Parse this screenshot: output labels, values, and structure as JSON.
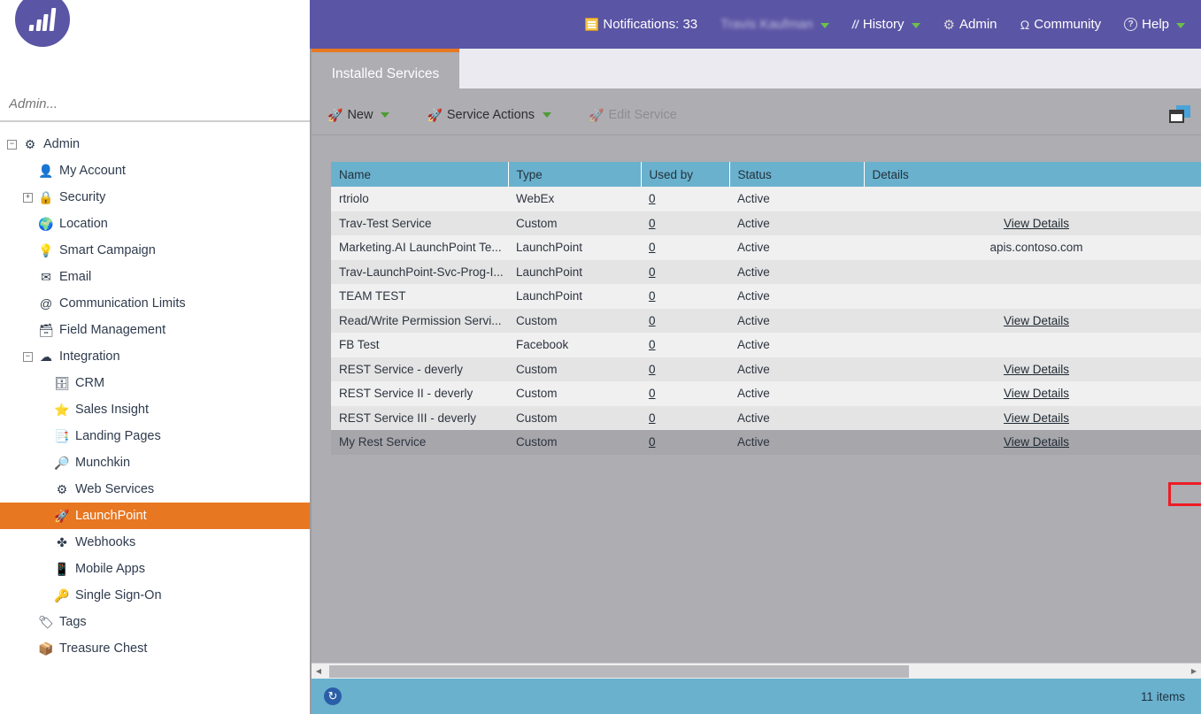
{
  "topbar": {
    "notifications": {
      "label": "Notifications: 33",
      "icon": "note-icon"
    },
    "user": {
      "label": "Travis Kaufman",
      "icon": "user-caret"
    },
    "history": {
      "label": "History",
      "icon": "footprints-icon"
    },
    "admin": {
      "label": "Admin",
      "icon": "gear-icon"
    },
    "community": {
      "label": "Community",
      "icon": "community-icon"
    },
    "help": {
      "label": "Help",
      "icon": "question-circle-icon"
    }
  },
  "sidebar": {
    "search_placeholder": "Admin...",
    "logo": "marketo-bars-logo",
    "items": [
      {
        "label": "Admin",
        "icon": "gear-icon",
        "depth": 0,
        "toggle": "minus",
        "selected": false
      },
      {
        "label": "My Account",
        "icon": "person-icon",
        "depth": 1,
        "toggle": "none",
        "selected": false
      },
      {
        "label": "Security",
        "icon": "lock-icon",
        "depth": 1,
        "toggle": "plus",
        "selected": false
      },
      {
        "label": "Location",
        "icon": "globe-pin-icon",
        "depth": 1,
        "toggle": "none",
        "selected": false
      },
      {
        "label": "Smart Campaign",
        "icon": "lightbulb-icon",
        "depth": 1,
        "toggle": "none",
        "selected": false
      },
      {
        "label": "Email",
        "icon": "envelope-icon",
        "depth": 1,
        "toggle": "none",
        "selected": false
      },
      {
        "label": "Communication Limits",
        "icon": "at-sign-icon",
        "depth": 1,
        "toggle": "none",
        "selected": false
      },
      {
        "label": "Field Management",
        "icon": "database-grid-icon",
        "depth": 1,
        "toggle": "none",
        "selected": false
      },
      {
        "label": "Integration",
        "icon": "cloud-icon",
        "depth": 1,
        "toggle": "minus",
        "selected": false
      },
      {
        "label": "CRM",
        "icon": "database-icon",
        "depth": 2,
        "toggle": "none",
        "selected": false
      },
      {
        "label": "Sales Insight",
        "icon": "star-flame-icon",
        "depth": 2,
        "toggle": "none",
        "selected": false
      },
      {
        "label": "Landing Pages",
        "icon": "page-layout-icon",
        "depth": 2,
        "toggle": "none",
        "selected": false
      },
      {
        "label": "Munchkin",
        "icon": "magnifier-globe-icon",
        "depth": 2,
        "toggle": "none",
        "selected": false
      },
      {
        "label": "Web Services",
        "icon": "gears-icon",
        "depth": 2,
        "toggle": "none",
        "selected": false
      },
      {
        "label": "LaunchPoint",
        "icon": "rocket-icon",
        "depth": 2,
        "toggle": "none",
        "selected": true
      },
      {
        "label": "Webhooks",
        "icon": "node-link-icon",
        "depth": 2,
        "toggle": "none",
        "selected": false
      },
      {
        "label": "Mobile Apps",
        "icon": "phone-icon",
        "depth": 2,
        "toggle": "none",
        "selected": false
      },
      {
        "label": "Single Sign-On",
        "icon": "key-icon",
        "depth": 2,
        "toggle": "none",
        "selected": false
      },
      {
        "label": "Tags",
        "icon": "tag-icon",
        "depth": 1,
        "toggle": "none",
        "selected": false
      },
      {
        "label": "Treasure Chest",
        "icon": "chest-icon",
        "depth": 1,
        "toggle": "none",
        "selected": false
      }
    ]
  },
  "main": {
    "tab_label": "Installed Services",
    "toolbar": {
      "new_label": "New",
      "service_actions_label": "Service Actions",
      "edit_service_label": "Edit Service",
      "window_toggle": "panel-toggle-icon"
    },
    "table": {
      "columns": [
        "Name",
        "Type",
        "Used by",
        "Status",
        "Details"
      ],
      "rows": [
        {
          "name": "rtriolo",
          "type": "WebEx",
          "used_by": "0",
          "status": "Active",
          "details": "",
          "details_link": false,
          "selected": false
        },
        {
          "name": "Trav-Test Service",
          "type": "Custom",
          "used_by": "0",
          "status": "Active",
          "details": "View Details",
          "details_link": true,
          "selected": false
        },
        {
          "name": "Marketing.AI LaunchPoint Te...",
          "type": "LaunchPoint",
          "used_by": "0",
          "status": "Active",
          "details": "apis.contoso.com",
          "details_link": false,
          "selected": false
        },
        {
          "name": "Trav-LaunchPoint-Svc-Prog-I...",
          "type": "LaunchPoint",
          "used_by": "0",
          "status": "Active",
          "details": "",
          "details_link": false,
          "selected": false
        },
        {
          "name": "TEAM TEST",
          "type": "LaunchPoint",
          "used_by": "0",
          "status": "Active",
          "details": "",
          "details_link": false,
          "selected": false
        },
        {
          "name": "Read/Write Permission Servi...",
          "type": "Custom",
          "used_by": "0",
          "status": "Active",
          "details": "View Details",
          "details_link": true,
          "selected": false
        },
        {
          "name": "FB Test",
          "type": "Facebook",
          "used_by": "0",
          "status": "Active",
          "details": "",
          "details_link": false,
          "selected": false
        },
        {
          "name": "REST Service - deverly",
          "type": "Custom",
          "used_by": "0",
          "status": "Active",
          "details": "View Details",
          "details_link": true,
          "selected": false
        },
        {
          "name": "REST Service II - deverly",
          "type": "Custom",
          "used_by": "0",
          "status": "Active",
          "details": "View Details",
          "details_link": true,
          "selected": false
        },
        {
          "name": "REST Service III - deverly",
          "type": "Custom",
          "used_by": "0",
          "status": "Active",
          "details": "View Details",
          "details_link": true,
          "selected": false
        },
        {
          "name": "My Rest Service",
          "type": "Custom",
          "used_by": "0",
          "status": "Active",
          "details": "View Details",
          "details_link": true,
          "selected": true
        }
      ]
    },
    "statusbar": {
      "refresh_icon": "refresh-icon",
      "items_label": "11 items"
    }
  },
  "annotation": {
    "highlight_color": "#ee1c25",
    "highlight_target": "View Details"
  },
  "colors": {
    "brand_purple": "#5b55a5",
    "accent_orange": "#e87722",
    "header_blue": "#6ab1ce",
    "panel_gray": "#adadb2"
  }
}
